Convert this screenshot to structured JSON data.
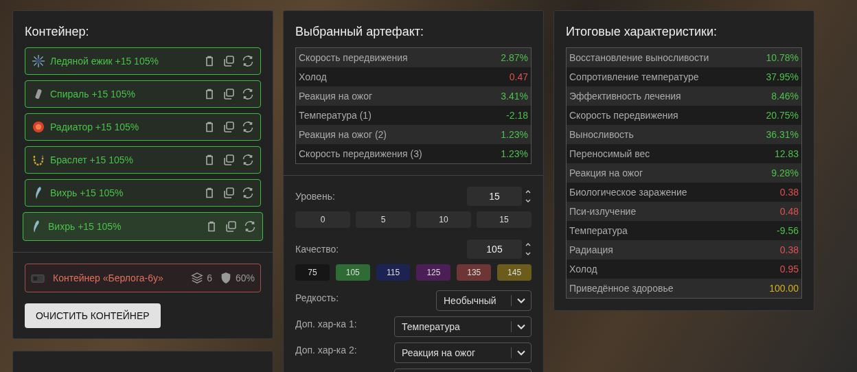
{
  "container_panel": {
    "title": "Контейнер:",
    "artifacts": [
      {
        "kind": "hedgehog",
        "label": "Ледяной ежик +15 105%",
        "selected": false
      },
      {
        "kind": "spiral",
        "label": "Спираль +15 105%",
        "selected": false
      },
      {
        "kind": "radiator",
        "label": "Радиатор +15 105%",
        "selected": false
      },
      {
        "kind": "bracelet",
        "label": "Браслет +15 105%",
        "selected": false
      },
      {
        "kind": "vortex",
        "label": "Вихрь +15 105%",
        "selected": false
      },
      {
        "kind": "vortex",
        "label": "Вихрь +15 105%",
        "selected": true
      }
    ],
    "container": {
      "name": "Контейнер «Берлога-6у»",
      "slots": "6",
      "protection": "60%"
    },
    "clear_button": "ОЧИСТИТЬ КОНТЕЙНЕР"
  },
  "artifact_panel": {
    "title": "Выбранный артефакт:",
    "stats": [
      {
        "name": "Скорость передвижения",
        "value": "2.87%",
        "color": "#4cc04c"
      },
      {
        "name": "Холод",
        "value": "0.47",
        "color": "#e05050"
      },
      {
        "name": "Реакция на ожог",
        "value": "3.41%",
        "color": "#4cc04c"
      },
      {
        "name": "Температура (1)",
        "value": "-2.18",
        "color": "#4cc04c"
      },
      {
        "name": "Реакция на ожог (2)",
        "value": "1.23%",
        "color": "#4cc04c"
      },
      {
        "name": "Скорость передвижения (3)",
        "value": "1.23%",
        "color": "#4cc04c"
      }
    ],
    "level": {
      "label": "Уровень:",
      "value": "15",
      "presets": [
        "0",
        "5",
        "10",
        "15"
      ]
    },
    "quality": {
      "label": "Качество:",
      "value": "105",
      "presets": [
        {
          "label": "75",
          "color": "#161616"
        },
        {
          "label": "105",
          "color": "#2f6b34"
        },
        {
          "label": "115",
          "color": "#1c2352"
        },
        {
          "label": "125",
          "color": "#4b1f55"
        },
        {
          "label": "135",
          "color": "#6e3535"
        },
        {
          "label": "145",
          "color": "#6b5c1c"
        }
      ]
    },
    "selects": [
      {
        "label": "Редкость:",
        "value": "Необычный",
        "kind": "short"
      },
      {
        "label": "Доп. хар-ка 1:",
        "value": "Температура",
        "kind": "wide"
      },
      {
        "label": "Доп. хар-ка 2:",
        "value": "Реакция на ожог",
        "kind": "wide"
      }
    ]
  },
  "totals_panel": {
    "title": "Итоговые характеристики:",
    "stats": [
      {
        "name": "Восстановление выносливости",
        "value": "10.78%",
        "color": "#4cc04c"
      },
      {
        "name": "Сопротивление температуре",
        "value": "37.95%",
        "color": "#4cc04c"
      },
      {
        "name": "Эффективность лечения",
        "value": "8.46%",
        "color": "#4cc04c"
      },
      {
        "name": "Скорость передвижения",
        "value": "20.75%",
        "color": "#4cc04c"
      },
      {
        "name": "Выносливость",
        "value": "36.31%",
        "color": "#4cc04c"
      },
      {
        "name": "Переносимый вес",
        "value": "12.83",
        "color": "#4cc04c"
      },
      {
        "name": "Реакция на ожог",
        "value": "9.28%",
        "color": "#4cc04c"
      },
      {
        "name": "Биологическое заражение",
        "value": "0.38",
        "color": "#e05050"
      },
      {
        "name": "Пси-излучение",
        "value": "0.48",
        "color": "#e05050"
      },
      {
        "name": "Температура",
        "value": "-9.56",
        "color": "#4cc04c"
      },
      {
        "name": "Радиация",
        "value": "0.38",
        "color": "#e05050"
      },
      {
        "name": "Холод",
        "value": "0.95",
        "color": "#e05050"
      },
      {
        "name": "Приведённое здоровье",
        "value": "100.00",
        "color": "#d4b020"
      }
    ]
  }
}
